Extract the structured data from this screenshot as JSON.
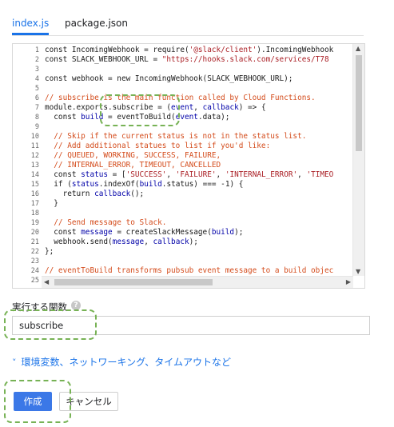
{
  "tabs": [
    {
      "label": "index.js",
      "active": true
    },
    {
      "label": "package.json",
      "active": false
    }
  ],
  "editor": {
    "lines": [
      {
        "n": "1",
        "segs": [
          [
            "t",
            "const IncomingWebhook = require("
          ],
          [
            "s",
            "'@slack/client'"
          ],
          [
            "t",
            ").IncomingWebhook"
          ]
        ]
      },
      {
        "n": "2",
        "segs": [
          [
            "t",
            "const SLACK_WEBHOOK_URL = "
          ],
          [
            "s",
            "\"https://hooks.slack.com/services/T78"
          ]
        ]
      },
      {
        "n": "3",
        "segs": [
          [
            "t",
            ""
          ]
        ]
      },
      {
        "n": "4",
        "segs": [
          [
            "t",
            "const webhook = new IncomingWebhook(SLACK_WEBHOOK_URL);"
          ]
        ]
      },
      {
        "n": "5",
        "segs": [
          [
            "t",
            ""
          ]
        ]
      },
      {
        "n": "6",
        "segs": [
          [
            "c",
            "// subscribe is the main function called by Cloud Functions."
          ]
        ]
      },
      {
        "n": "7",
        "segs": [
          [
            "t",
            "module.exports.subscribe = ("
          ],
          [
            "v",
            "event"
          ],
          [
            "t",
            ", "
          ],
          [
            "v",
            "callback"
          ],
          [
            "t",
            ") => {"
          ]
        ]
      },
      {
        "n": "8",
        "segs": [
          [
            "t",
            "  const "
          ],
          [
            "v",
            "build"
          ],
          [
            "t",
            " = eventToBuild("
          ],
          [
            "v",
            "event"
          ],
          [
            "t",
            ".data);"
          ]
        ]
      },
      {
        "n": "9",
        "segs": [
          [
            "t",
            ""
          ]
        ]
      },
      {
        "n": "10",
        "segs": [
          [
            "c",
            "  // Skip if the current status is not in the status list."
          ]
        ]
      },
      {
        "n": "11",
        "segs": [
          [
            "c",
            "  // Add additional statues to list if you'd like:"
          ]
        ]
      },
      {
        "n": "12",
        "segs": [
          [
            "c",
            "  // QUEUED, WORKING, SUCCESS, FAILURE,"
          ]
        ]
      },
      {
        "n": "13",
        "segs": [
          [
            "c",
            "  // INTERNAL_ERROR, TIMEOUT, CANCELLED"
          ]
        ]
      },
      {
        "n": "14",
        "segs": [
          [
            "t",
            "  const "
          ],
          [
            "v",
            "status"
          ],
          [
            "t",
            " = ["
          ],
          [
            "s",
            "'SUCCESS'"
          ],
          [
            "t",
            ", "
          ],
          [
            "s",
            "'FAILURE'"
          ],
          [
            "t",
            ", "
          ],
          [
            "s",
            "'INTERNAL_ERROR'"
          ],
          [
            "t",
            ", "
          ],
          [
            "s",
            "'TIMEO"
          ]
        ]
      },
      {
        "n": "15",
        "segs": [
          [
            "t",
            "  if ("
          ],
          [
            "v",
            "status"
          ],
          [
            "t",
            ".indexOf("
          ],
          [
            "v",
            "build"
          ],
          [
            "t",
            ".status) === -1) {"
          ]
        ]
      },
      {
        "n": "16",
        "segs": [
          [
            "t",
            "    return "
          ],
          [
            "v",
            "callback"
          ],
          [
            "t",
            "();"
          ]
        ]
      },
      {
        "n": "17",
        "segs": [
          [
            "t",
            "  }"
          ]
        ]
      },
      {
        "n": "18",
        "segs": [
          [
            "t",
            ""
          ]
        ]
      },
      {
        "n": "19",
        "segs": [
          [
            "c",
            "  // Send message to Slack."
          ]
        ]
      },
      {
        "n": "20",
        "segs": [
          [
            "t",
            "  const "
          ],
          [
            "v",
            "message"
          ],
          [
            "t",
            " = createSlackMessage("
          ],
          [
            "v",
            "build"
          ],
          [
            "t",
            ");"
          ]
        ]
      },
      {
        "n": "21",
        "segs": [
          [
            "t",
            "  webhook.send("
          ],
          [
            "v",
            "message"
          ],
          [
            "t",
            ", "
          ],
          [
            "v",
            "callback"
          ],
          [
            "t",
            ");"
          ]
        ]
      },
      {
        "n": "22",
        "segs": [
          [
            "t",
            "};"
          ]
        ]
      },
      {
        "n": "23",
        "segs": [
          [
            "t",
            ""
          ]
        ]
      },
      {
        "n": "24",
        "segs": [
          [
            "c",
            "// eventToBuild transforms pubsub event message to a build objec"
          ]
        ]
      },
      {
        "n": "25",
        "segs": [
          [
            "t",
            ""
          ]
        ]
      }
    ]
  },
  "function_field": {
    "label": "実行する関数",
    "help_icon": "?",
    "value": "subscribe"
  },
  "advanced_link": {
    "chevron": "˅",
    "label": "環境変数、ネットワーキング、タイムアウトなど"
  },
  "buttons": {
    "create": "作成",
    "cancel": "キャンセル"
  },
  "colors": {
    "accent": "#1a73e8",
    "primary_button": "#3b78e7",
    "comment": "#d44c1c",
    "string": "#aa1f25",
    "highlight": "#77b255"
  }
}
